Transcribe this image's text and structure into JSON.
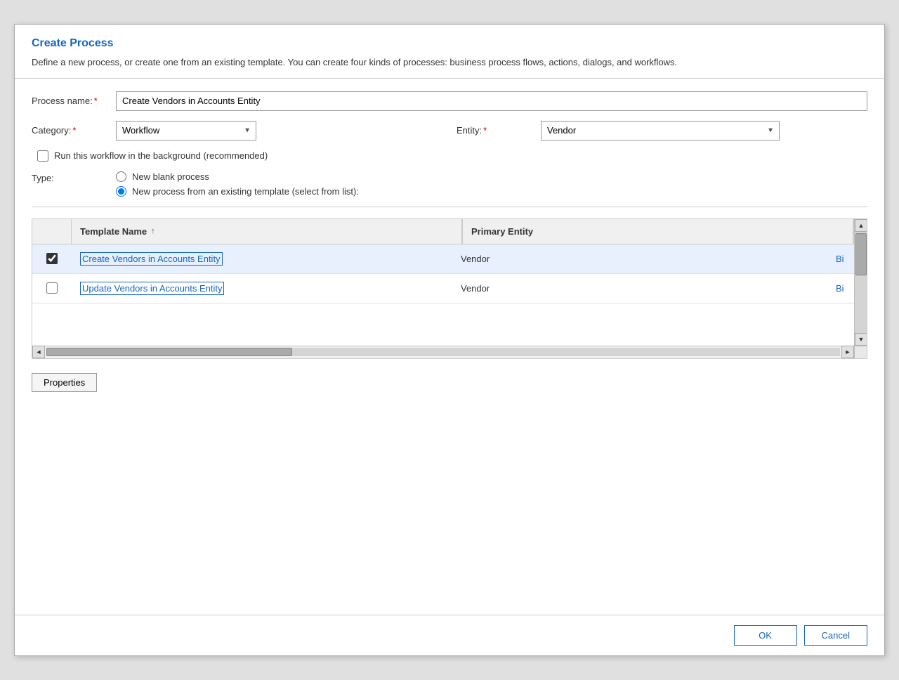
{
  "dialog": {
    "title": "Create Process",
    "description": "Define a new process, or create one from an existing template. You can create four kinds of processes: business process flows, actions, dialogs, and workflows."
  },
  "form": {
    "process_name_label": "Process name:",
    "process_name_value": "Create Vendors in Accounts Entity",
    "category_label": "Category:",
    "category_value": "Workflow",
    "entity_label": "Entity:",
    "entity_value": "Vendor",
    "required_star": "*",
    "checkbox_label": "Run this workflow in the background (recommended)",
    "type_label": "Type:",
    "radio_option1": "New blank process",
    "radio_option2": "New process from an existing template (select from list):"
  },
  "table": {
    "col_template_name": "Template Name",
    "col_primary_entity": "Primary Entity",
    "sort_indicator": "↑",
    "rows": [
      {
        "id": 1,
        "name": "Create Vendors in Accounts Entity",
        "entity": "Vendor",
        "extra": "Bi",
        "checked": true
      },
      {
        "id": 2,
        "name": "Update Vendors in Accounts Entity",
        "entity": "Vendor",
        "extra": "Bi",
        "checked": false
      }
    ]
  },
  "buttons": {
    "properties": "Properties",
    "ok": "OK",
    "cancel": "Cancel"
  },
  "icons": {
    "scroll_up": "▲",
    "scroll_down": "▼",
    "scroll_left": "◄",
    "scroll_right": "►",
    "dropdown_arrow": "▼"
  }
}
